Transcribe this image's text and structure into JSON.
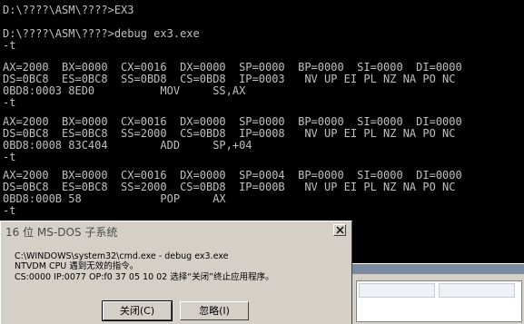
{
  "console": {
    "lines": [
      "D:\\????\\ASM\\????>EX3",
      "",
      "D:\\????\\ASM\\????>debug ex3.exe",
      "-t",
      "",
      "AX=2000  BX=0000  CX=0016  DX=0000  SP=0000  BP=0000  SI=0000  DI=0000",
      "DS=0BC8  ES=0BC8  SS=0BD8  CS=0BD8  IP=0003   NV UP EI PL NZ NA PO NC",
      "0BD8:0003 8ED0          MOV     SS,AX",
      "-t",
      "",
      "AX=2000  BX=0000  CX=0016  DX=0000  SP=0000  BP=0000  SI=0000  DI=0000",
      "DS=0BC8  ES=0BC8  SS=2000  CS=0BD8  IP=0008   NV UP EI PL NZ NA PO NC",
      "0BD8:0008 83C404        ADD     SP,+04",
      "-t",
      "",
      "AX=2000  BX=0000  CX=0016  DX=0000  SP=0004  BP=0000  SI=0000  DI=0000",
      "DS=0BC8  ES=0BC8  SS=2000  CS=0BD8  IP=000B   NV UP EI PL NZ NA PO NC",
      "0BD8:000B 58            POP     AX",
      "-t"
    ]
  },
  "dialog": {
    "title": "16 位 MS-DOS 子系统",
    "message_lines": [
      "C:\\WINDOWS\\system32\\cmd.exe - debug ex3.exe",
      "NTVDM CPU 遇到无效的指令。",
      "CS:0000 IP:0077 OP:f0 37 05 10 02 选择“关闭”终止应用程序。"
    ],
    "close_button_label": "关闭(C)",
    "ignore_button_label": "忽略(I)"
  }
}
